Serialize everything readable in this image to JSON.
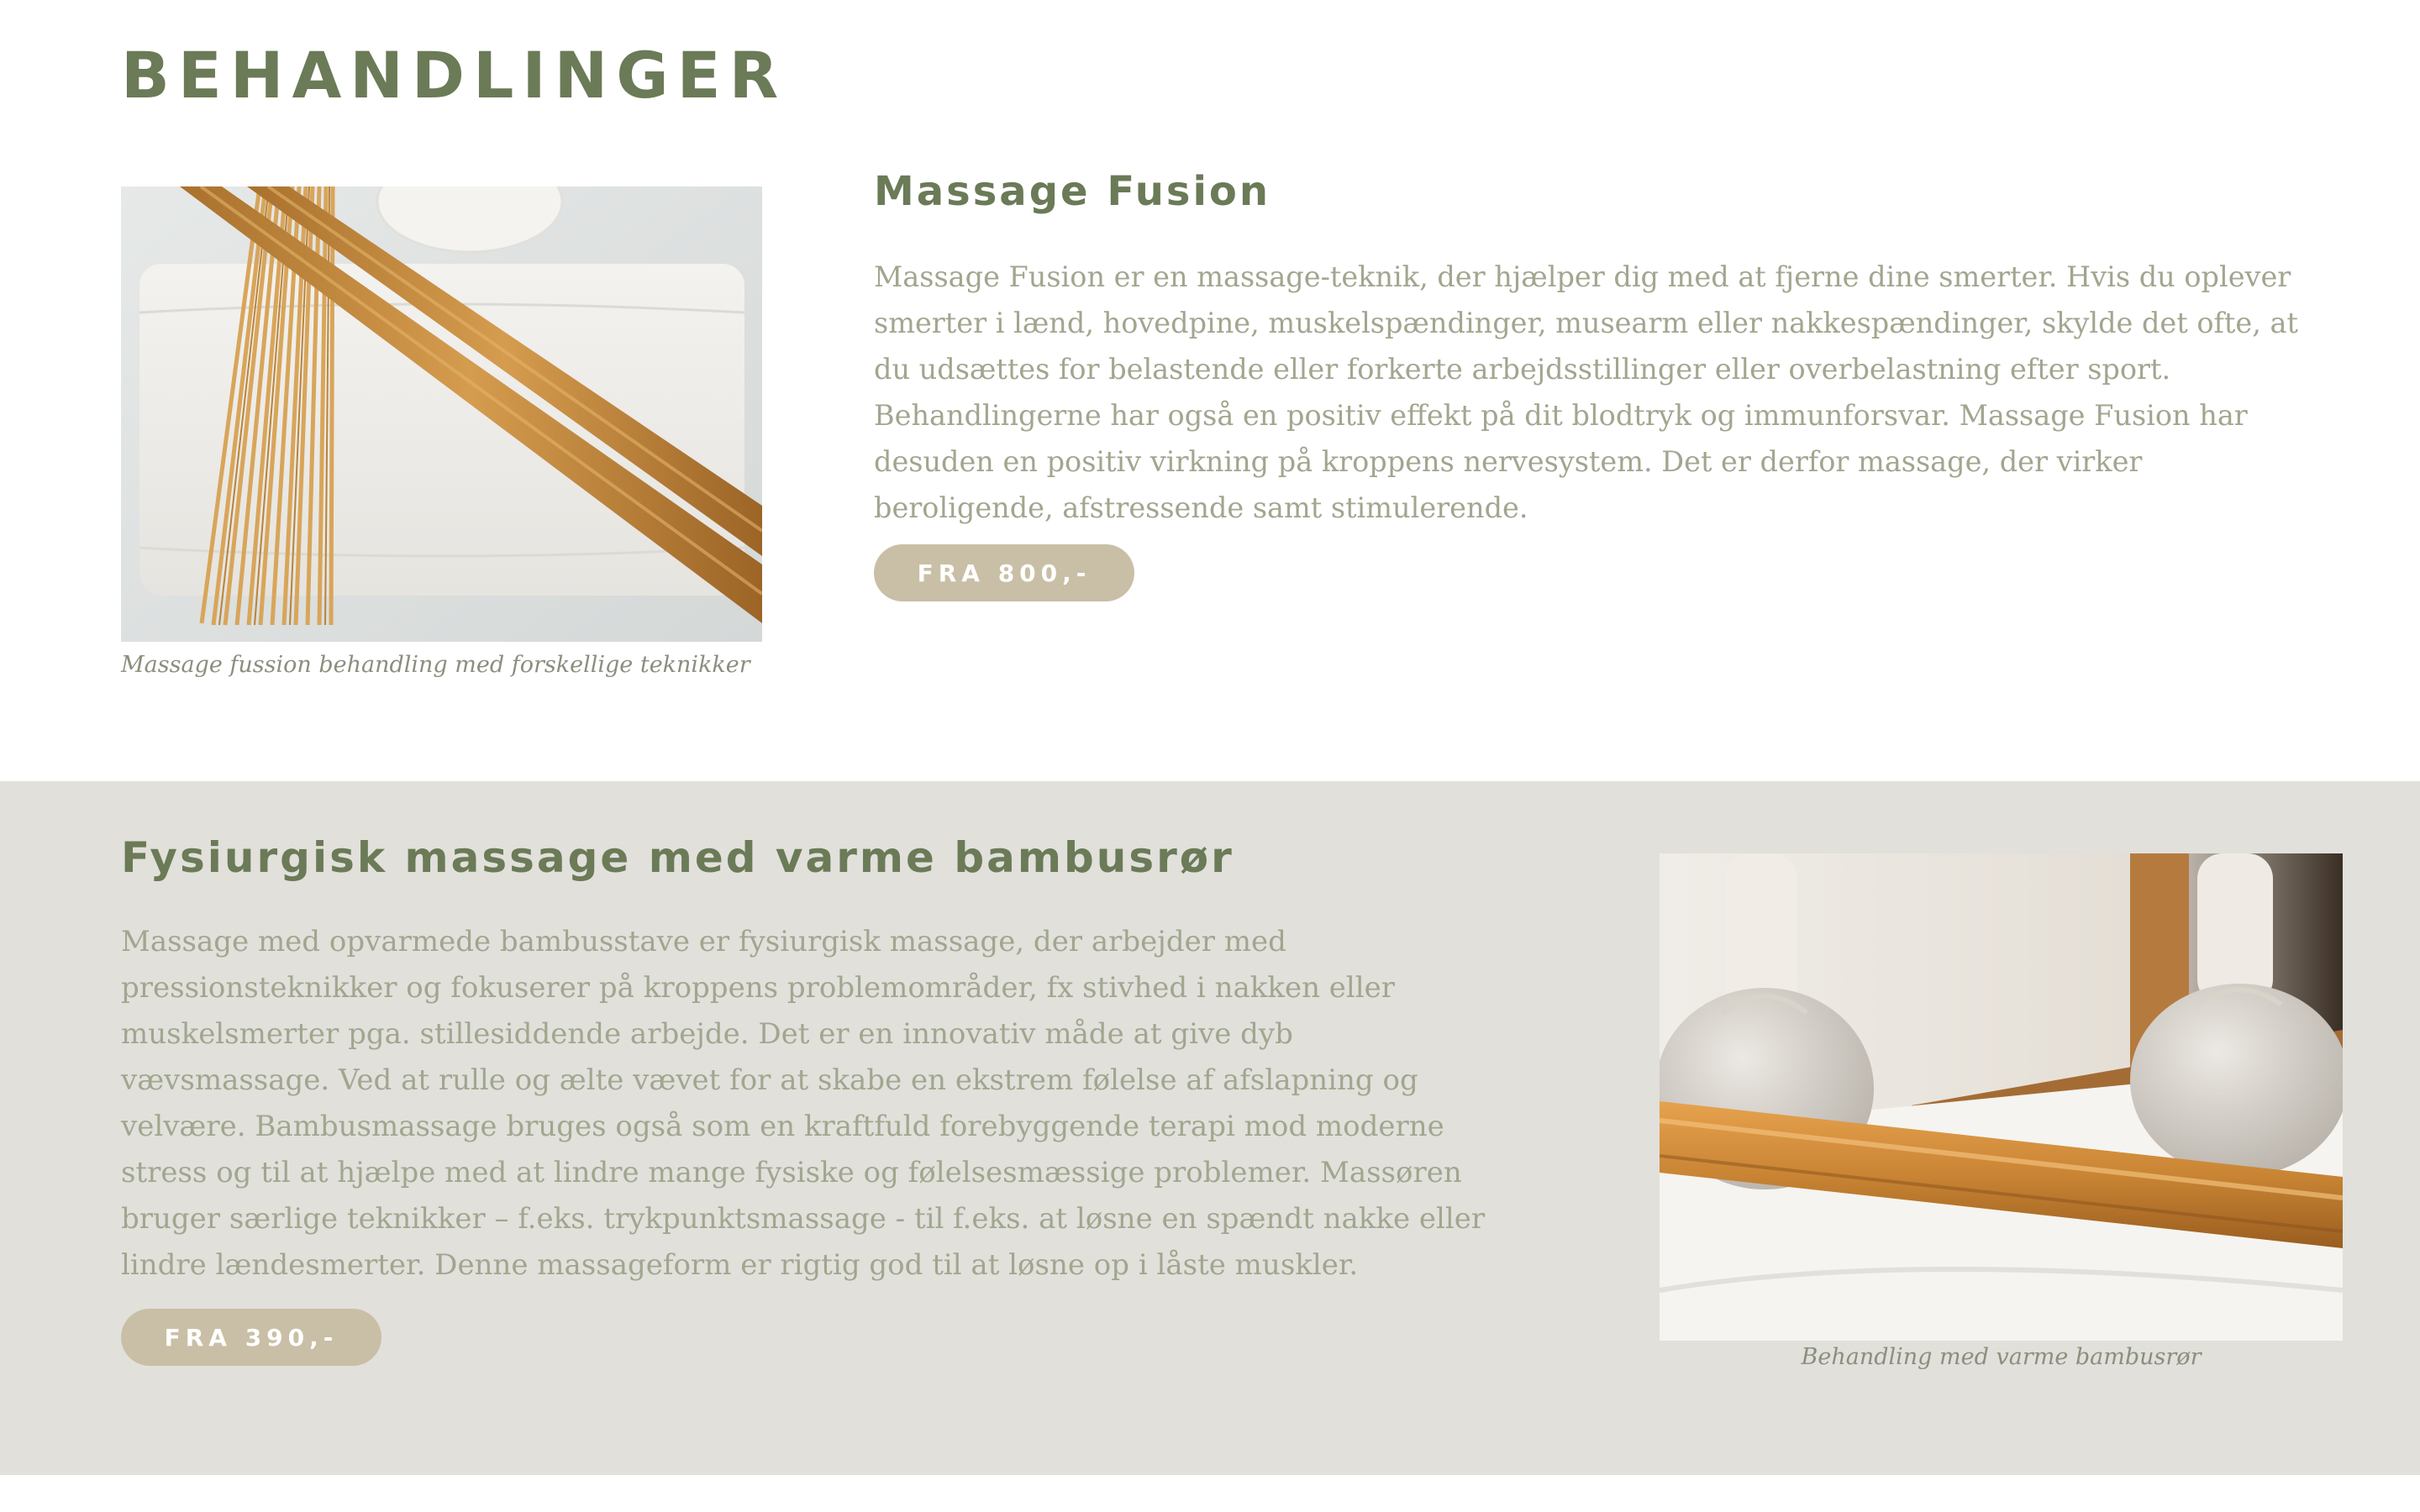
{
  "page": {
    "title": "BEHANDLINGER"
  },
  "treatments": [
    {
      "title": "Massage Fusion",
      "description": "Massage Fusion er en massage-teknik, der hjælper dig med at fjerne dine smerter. Hvis du oplever smerter i lænd, hovedpine, muskelspændinger, musearm eller nakkespændinger, skylde det ofte, at du udsættes for belastende eller forkerte arbejdsstillinger eller overbelastning efter sport. Behandlingerne har også en positiv effekt på dit blodtryk og immunforsvar. Massage Fusion har desuden en positiv virkning på kroppens nervesystem. Det er derfor massage, der virker beroligende, afstressende samt stimulerende.",
      "price_label": "FRA 800,-",
      "image_caption": "Massage fussion behandling med forskellige teknikker"
    },
    {
      "title": "Fysiurgisk massage med varme bambusrør",
      "description": "Massage med opvarmede bambusstave er fysiurgisk massage, der arbejder med pressionsteknikker og fokuserer på kroppens problemområder, fx stivhed i nakken eller muskelsmerter pga. stillesiddende arbejde. Det er en innovativ måde at give dyb vævsmassage. Ved at rulle og ælte vævet for at skabe en ekstrem følelse af afslapning og velvære. Bambusmassage bruges også som en kraftfuld forebyggende terapi mod moderne stress og til at hjælpe med at lindre mange fysiske og følelsesmæssige problemer. Massøren bruger særlige teknikker – f.eks. trykpunktsmassage - til f.eks. at løsne en spændt nakke eller lindre lændesmerter. Denne massageform er rigtig god til at løsne op i låste muskler.",
      "price_label": "FRA 390,-",
      "image_caption": "Behandling med varme bambusrør"
    }
  ],
  "colors": {
    "heading": "#6b7a57",
    "body_text": "#a1a68f",
    "button": "#c9bfa6",
    "section_alt_bg": "#e1e0db"
  }
}
